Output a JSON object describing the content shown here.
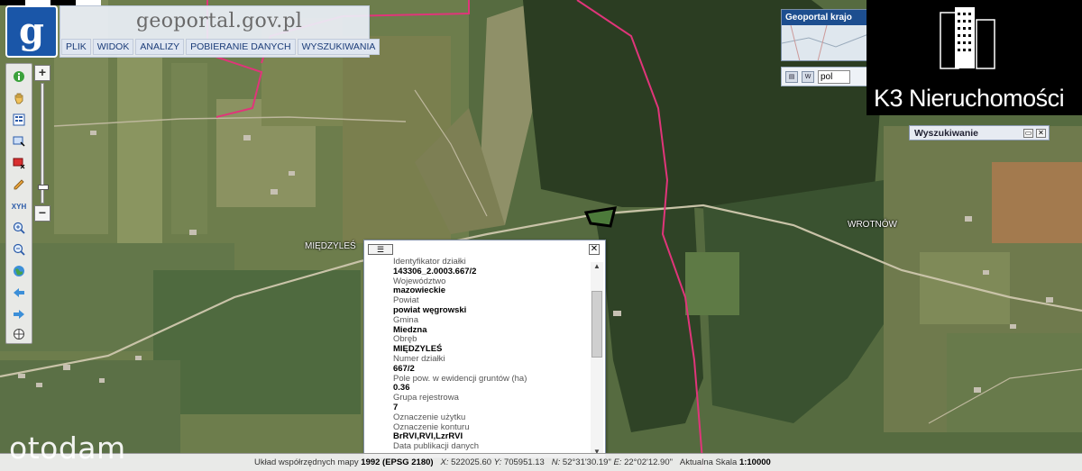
{
  "header": {
    "logo_letter": "g",
    "brand": "geoportal.gov.pl",
    "menu": [
      "PLIK",
      "WIDOK",
      "ANALIZY",
      "POBIERANIE DANYCH",
      "WYSZUKIWANIA"
    ]
  },
  "toolbar": {
    "tools": [
      "info-icon",
      "hand-pan-icon",
      "legend-icon",
      "select-area-icon",
      "clear-selection-icon",
      "pencil-icon",
      "xyz-coordinates-icon",
      "zoom-in-icon",
      "zoom-out-icon",
      "globe-icon",
      "back-arrow-icon",
      "forward-arrow-icon",
      "crosshair-icon"
    ],
    "xyz_label": "XYH",
    "zoom_plus": "+",
    "zoom_minus": "−"
  },
  "overview": {
    "title": "Geoportal krajo"
  },
  "language": {
    "value": "pol"
  },
  "brand_k3": {
    "name": "K3 Nieruchomości",
    "accent": "#ffffff"
  },
  "search_panel": {
    "title": "Wyszukiwanie"
  },
  "places": [
    "MIĘDZYLEŚ",
    "WROTNÓW"
  ],
  "popup": {
    "fields": [
      {
        "label": "Identyfikator działki",
        "value": "143306_2.0003.667/2"
      },
      {
        "label": "Województwo",
        "value": "mazowieckie"
      },
      {
        "label": "Powiat",
        "value": "powiat węgrowski"
      },
      {
        "label": "Gmina",
        "value": "Miedzna"
      },
      {
        "label": "Obręb",
        "value": "MIĘDZYLEŚ"
      },
      {
        "label": "Numer działki",
        "value": "667/2"
      },
      {
        "label": "Pole pow. w ewidencji gruntów (ha)",
        "value": "0.36"
      },
      {
        "label": "Grupa rejestrowa",
        "value": "7"
      },
      {
        "label": "Oznaczenie użytku",
        "value": ""
      },
      {
        "label": "Oznaczenie konturu",
        "value": "BrRVI,RVI,LzrRVI"
      },
      {
        "label": "Data publikacji danych",
        "value": ""
      }
    ]
  },
  "status": {
    "crs_label": "Układ współrzędnych mapy",
    "crs_value": "1992 (EPSG 2180)",
    "x_label": "X:",
    "x_value": "522025.60",
    "y_label": "Y:",
    "y_value": "705951.13",
    "n_label": "N:",
    "n_value": "52°31'30.19\"",
    "e_label": "E:",
    "e_value": "22°02'12.90\"",
    "scale_label": "Aktualna Skala",
    "scale_value": "1:10000"
  },
  "watermark": "otodam",
  "colors": {
    "boundary": "#e0357a",
    "parcel_outline": "#000000",
    "header_blue": "#1a56a8"
  }
}
